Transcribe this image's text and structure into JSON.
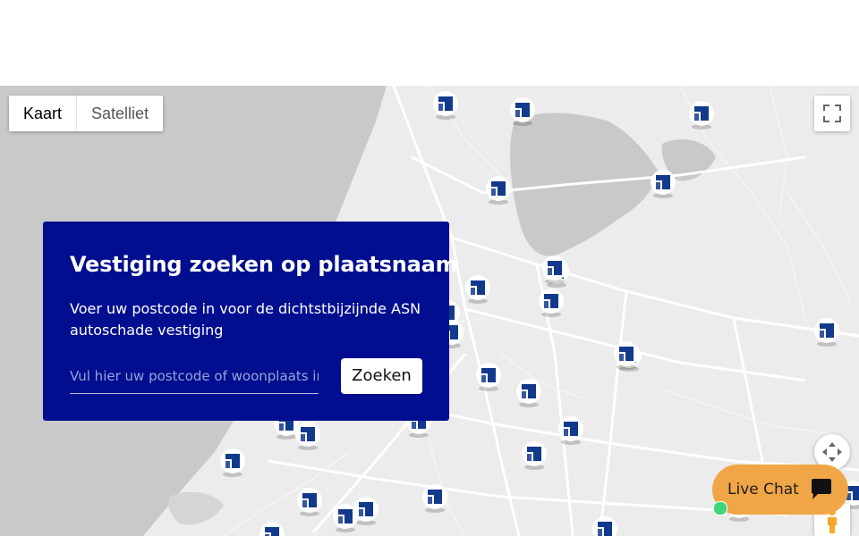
{
  "map_type": {
    "map_label": "Kaart",
    "satellite_label": "Satelliet"
  },
  "search_panel": {
    "title": "Vestiging zoeken op plaatsnaam",
    "description": "Voer uw postcode in voor de dichtstbijzijnde ASN autoschade vestiging",
    "input_placeholder": "Vul hier uw postcode of woonplaats in",
    "button_label": "Zoeken"
  },
  "live_chat": {
    "label": "Live Chat",
    "status_color": "#3ed67a"
  },
  "colors": {
    "panel_bg": "#000e8f",
    "marker_blue": "#123a8c",
    "chat_bg": "#f0a646",
    "water": "#c9c9c9",
    "land": "#ececec"
  },
  "icons": {
    "fullscreen": "fullscreen-icon",
    "rotate": "rotate-icon",
    "pegman": "pegman-icon",
    "chat": "chat-bubble-icon",
    "marker": "asn-location-marker"
  },
  "marker_count": 30
}
